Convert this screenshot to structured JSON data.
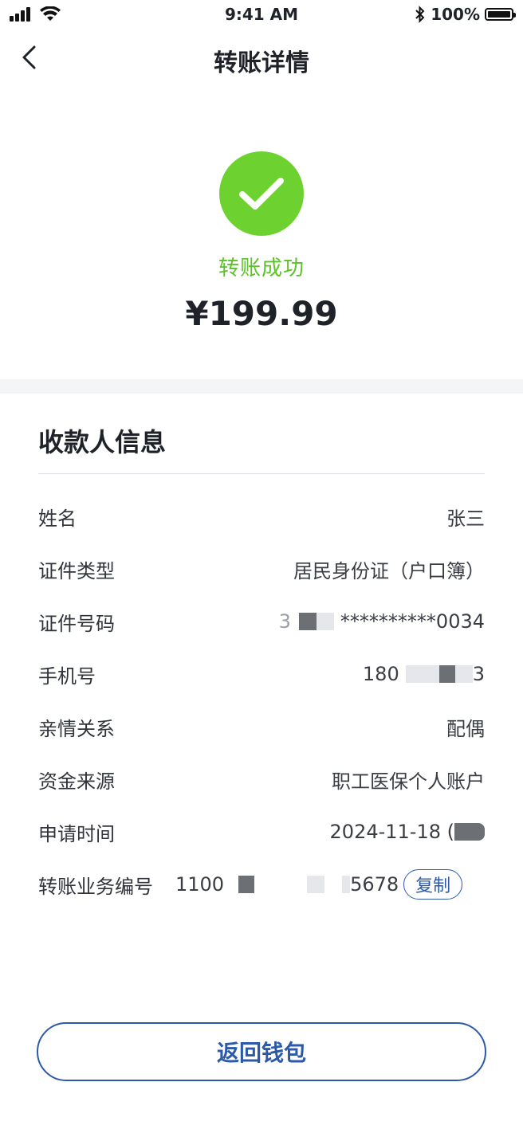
{
  "status_bar": {
    "time": "9:41 AM",
    "battery": "100%",
    "icons": [
      "signal-icon",
      "wifi-icon",
      "bluetooth-icon",
      "battery-icon"
    ]
  },
  "nav": {
    "title": "转账详情",
    "back_icon": "chevron-left-icon"
  },
  "result": {
    "icon": "checkmark-icon",
    "status": "转账成功",
    "amount": "¥199.99",
    "status_color": "#5cc12a"
  },
  "payee": {
    "title": "收款人信息",
    "rows": [
      {
        "label": "姓名",
        "value": "张三"
      },
      {
        "label": "证件类型",
        "value": "居民身份证（户口簿）"
      },
      {
        "label": "证件号码",
        "value_prefix": "3",
        "value": "**********0034"
      },
      {
        "label": "手机号",
        "value_prefix": "180",
        "value": "3"
      },
      {
        "label": "亲情关系",
        "value": "配偶"
      },
      {
        "label": "资金来源",
        "value": "职工医保个人账户"
      },
      {
        "label": "申请时间",
        "value": "2024-11-18 ("
      },
      {
        "label": "转账业务编号",
        "value_prefix": "1100",
        "value": "5678",
        "action": "复制"
      }
    ]
  },
  "footer": {
    "button_label": "返回钱包"
  },
  "colors": {
    "accent": "#2c5aa8",
    "success": "#6dd22f"
  }
}
